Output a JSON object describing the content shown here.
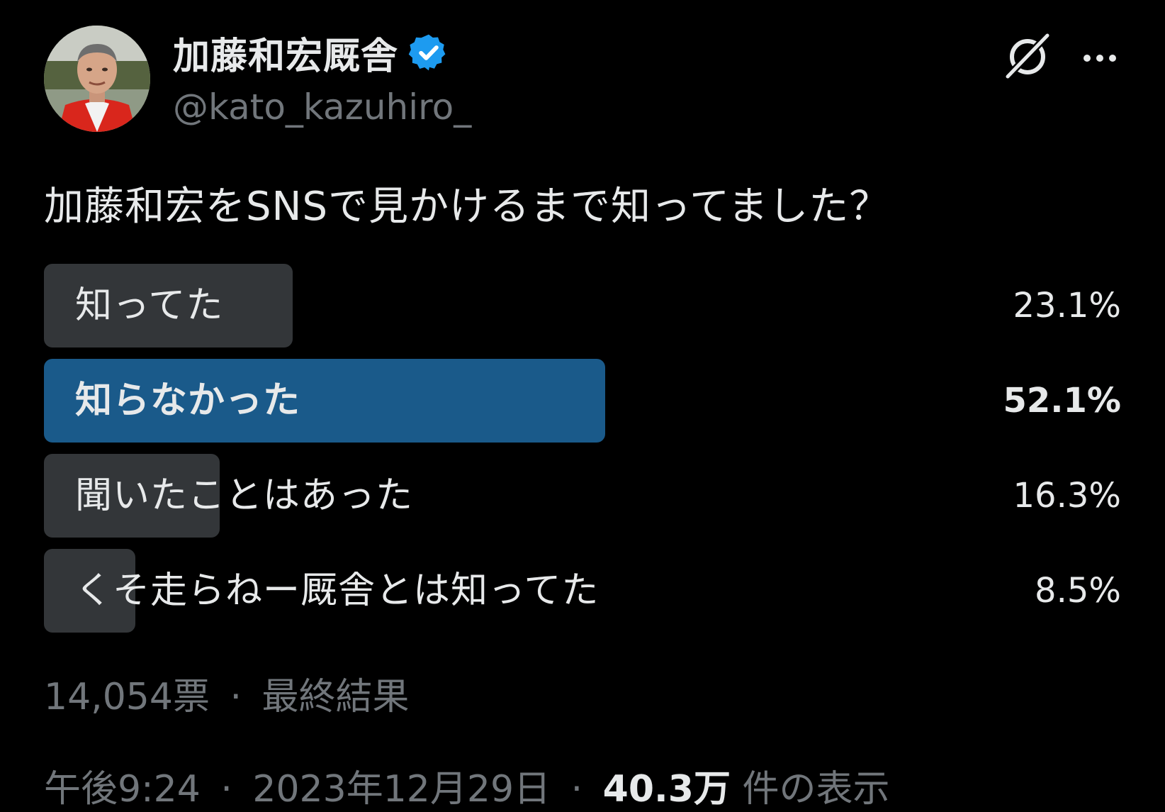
{
  "author": {
    "display_name": "加藤和宏厩舎",
    "handle": "@kato_kazuhiro_",
    "verified_icon": "verified-badge-icon"
  },
  "header_actions": {
    "grok_icon": "grok-icon",
    "more_icon": "more-icon"
  },
  "tweet": {
    "text": "加藤和宏をSNSで見かけるまで知ってました？"
  },
  "poll": {
    "options": [
      {
        "label": "知ってた",
        "percent_text": "23.1%",
        "percent": 23.1,
        "winner": false
      },
      {
        "label": "知らなかった",
        "percent_text": "52.1%",
        "percent": 52.1,
        "winner": true
      },
      {
        "label": "聞いたことはあった",
        "percent_text": "16.3%",
        "percent": 16.3,
        "winner": false
      },
      {
        "label": "くそ走らねー厩舎とは知ってた",
        "percent_text": "8.5%",
        "percent": 8.5,
        "winner": false
      }
    ],
    "votes": "14,054票",
    "separator": "·",
    "status": "最終結果"
  },
  "meta": {
    "time": "午後9:24",
    "separator": "·",
    "date": "2023年12月29日",
    "views_count": "40.3万",
    "views_label": "件の表示"
  },
  "colors": {
    "background": "#000000",
    "text_primary": "#e7e9ea",
    "text_secondary": "#71767b",
    "poll_bar": "#333639",
    "poll_bar_winner": "#1a5a8a",
    "verified_blue": "#1d9bf0"
  }
}
